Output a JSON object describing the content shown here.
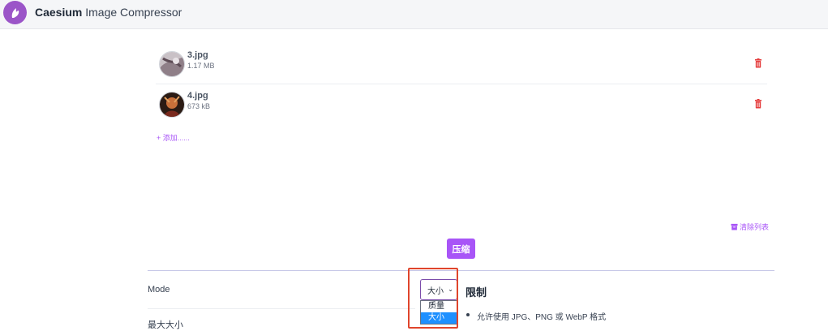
{
  "app": {
    "brand": "Caesium",
    "title_rest": " Image Compressor"
  },
  "files": [
    {
      "name": "3.jpg",
      "size": "1.17 MB"
    },
    {
      "name": "4.jpg",
      "size": "673 kB"
    }
  ],
  "actions": {
    "add": "+ 添加......",
    "clear": "清除列表",
    "compress": "压缩"
  },
  "settings": {
    "mode_label": "Mode",
    "mode_value": "大小",
    "mode_options": [
      "质量",
      "大小"
    ],
    "max_size_label": "最大大小"
  },
  "limits": {
    "title": "限制",
    "items": [
      "允许使用 JPG、PNG 或 WebP 格式"
    ]
  },
  "colors": {
    "accent": "#a855f7",
    "danger": "#e0452c",
    "highlight": "#1e90ff"
  }
}
